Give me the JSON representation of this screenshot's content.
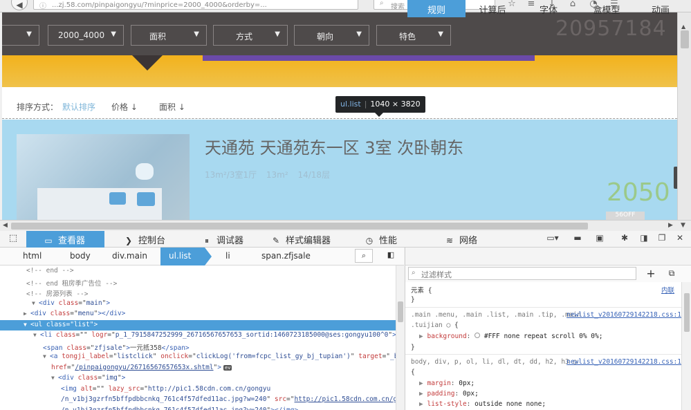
{
  "browser": {
    "url": "...zj.58.com/pinpaigongyu/?minprice=2000_4000&orderby=...",
    "search_placeholder": "搜索"
  },
  "page": {
    "filters": [
      "",
      "2000_4000",
      "面积",
      "方式",
      "朝向",
      "特色"
    ],
    "bg_number": "20957184",
    "sort": {
      "label": "排序方式：",
      "default": "默认排序",
      "price": "价格 ↓",
      "area": "面积 ↓"
    },
    "tooltip": {
      "selector": "ul.list",
      "size": "1040 × 3820"
    },
    "listing": {
      "title": "天通苑 天通苑东一区 3室 次卧朝东",
      "meta": "13m²/3室1厅 13m² 14/18层",
      "price": "2050",
      "tag": "56OFF"
    }
  },
  "devtools": {
    "tabs": [
      {
        "label": "查看器",
        "icon": "inspector-icon"
      },
      {
        "label": "控制台",
        "icon": "console-icon"
      },
      {
        "label": "调试器",
        "icon": "debugger-icon"
      },
      {
        "label": "样式编辑器",
        "icon": "style-editor-icon"
      },
      {
        "label": "性能",
        "icon": "performance-icon"
      },
      {
        "label": "网络",
        "icon": "network-icon"
      }
    ],
    "breadcrumbs": [
      "html",
      "body",
      "div.main",
      "ul.list",
      "li",
      "span.zfjsale"
    ],
    "markup": [
      {
        "indent": 0,
        "twisty": "",
        "kind": "comment",
        "text": "<!-- end -->"
      },
      {
        "indent": 0,
        "twisty": "",
        "kind": "comment",
        "text": "<!-- end 租房季广告位 -->"
      },
      {
        "indent": 0,
        "twisty": "",
        "kind": "comment",
        "text": "<!-- 房源列表 -->"
      },
      {
        "indent": 0,
        "twisty": "▼",
        "kind": "tag",
        "html": "<span class=\"tg\">&lt;div</span> <span class=\"at\">class</span>=\"<span class=\"av\">main</span>\"<span class=\"tg\">&gt;</span>"
      },
      {
        "indent": 1,
        "twisty": "▶",
        "kind": "tag",
        "html": "<span class=\"tg\">&lt;div</span> <span class=\"at\">class</span>=\"<span class=\"av\">menu</span>\"<span class=\"tg\">&gt;&lt;/div&gt;</span>"
      },
      {
        "indent": 1,
        "twisty": "▼",
        "kind": "selected",
        "html": "&lt;ul class=\"list\"&gt;"
      },
      {
        "indent": 2,
        "twisty": "▼",
        "kind": "tag",
        "html": "<span class=\"tg\">&lt;li</span> <span class=\"at\">class</span>=\"\" <span class=\"at\">logr</span>=\"<span class=\"av\">p_1_7915847252999_26716567657653_sortid:1460723185000@ses:gongyu100^0</span>\"<span class=\"tg\">&gt;</span><span class=\"ev\">ev</span>"
      },
      {
        "indent": 3,
        "twisty": "",
        "kind": "tag",
        "html": "<span class=\"tg\">&lt;span</span> <span class=\"at\">class</span>=\"<span class=\"av\">zfjsale</span>\"<span class=\"tg\">&gt;</span>一元抵358<span class=\"tg\">&lt;/span&gt;</span>"
      },
      {
        "indent": 3,
        "twisty": "▼",
        "kind": "tag",
        "html": "<span class=\"tg\">&lt;a</span> <span class=\"at\">tongji_label</span>=\"<span class=\"av\">listclick</span>\" <span class=\"at\">onclick</span>=\"<span class=\"av\">clickLog('from=fcpc_list_gy_bj_tupian')</span>\" <span class=\"at\">target</span>=\"<span class=\"av\">_blank</span>\""
      },
      {
        "indent": 4,
        "twisty": "",
        "kind": "tag",
        "html": "<span class=\"at\">href</span>=\"<span class=\"lk\">/pinpaigongyu/26716567657653x.shtml</span>\"<span class=\"tg\">&gt;</span><span class=\"ev\">ev</span>"
      },
      {
        "indent": 4,
        "twisty": "▼",
        "kind": "tag",
        "html": "<span class=\"tg\">&lt;div</span> <span class=\"at\">class</span>=\"<span class=\"av\">img</span>\"<span class=\"tg\">&gt;</span>"
      },
      {
        "indent": 5,
        "twisty": "",
        "kind": "tag",
        "html": "<span class=\"tg\">&lt;img</span> <span class=\"at\">alt</span>=\"\" <span class=\"at\">lazy_src</span>=\"<span class=\"av\">http://pic1.58cdn.com.cn/gongyu</span>"
      },
      {
        "indent": 5,
        "twisty": "",
        "kind": "tag",
        "html": "<span class=\"av\">/n_v1bj3gzrfn5bffpdbbcnkq_761c4f57dfed11ac.jpg?w=240</span>\" <span class=\"at\">src</span>=\"<span class=\"lk\">http://pic1.58cdn.com.cn/gongyu</span>"
      },
      {
        "indent": 5,
        "twisty": "",
        "kind": "tag",
        "html": "<span class=\"lk\">/n_v1bj3gzrfn5bffpdbbcnkq_761c4f57dfed11ac.jpg?w=240</span>\"<span class=\"tg\">&gt;&lt;/img&gt;</span>"
      }
    ],
    "sidebar_tabs": [
      "规则",
      "计算后",
      "字体",
      "盒模型",
      "动画"
    ],
    "filter_placeholder": "过滤样式",
    "rules": {
      "element": "元素 {",
      "element_close": "}",
      "inline": "内联",
      "rule1_selector": ".main .menu, .main .list, .main .tip, .main",
      "rule1_selector_cont": ".tuijian",
      "rule1_source": "newlist_v20160729142218.css:1",
      "rule1_prop": "background",
      "rule1_val": "#FFF none repeat scroll 0% 0%;",
      "rule2_selector": "body, div, p, ol, li, dl, dt, dd, h2, h3",
      "rule2_source": "newlist_v20160729142218.css:1",
      "rule2_props": [
        {
          "name": "margin",
          "value": "0px;"
        },
        {
          "name": "padding",
          "value": "0px;"
        },
        {
          "name": "list-style",
          "value": "outside none none;"
        }
      ]
    }
  },
  "colors": {
    "accent": "#4c9ed9",
    "highlight": "#a8d9f0",
    "banner": "#f2b21c"
  }
}
